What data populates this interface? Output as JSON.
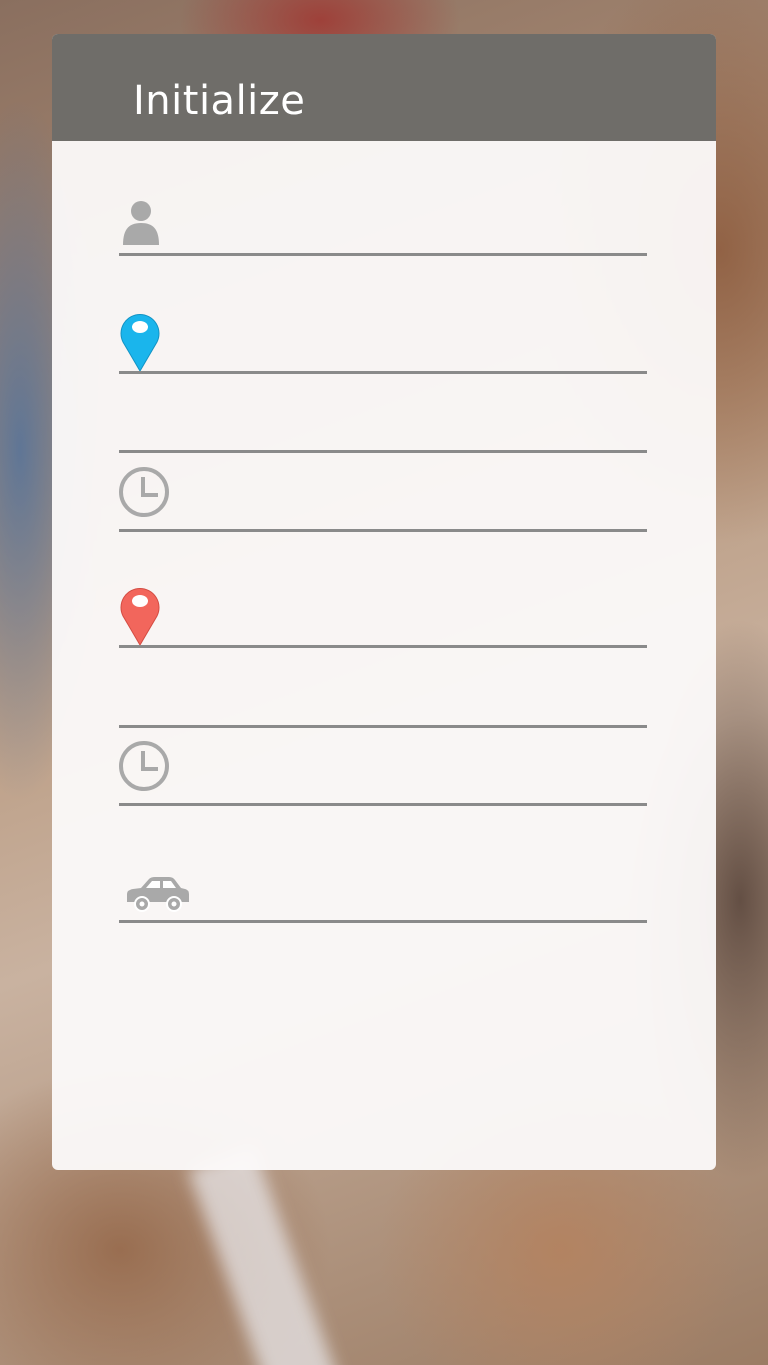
{
  "header": {
    "title": "Initialize"
  },
  "form": {
    "fields": [
      {
        "name": "name",
        "icon": "person-icon",
        "value": ""
      },
      {
        "name": "pickup-location",
        "icon": "pin-blue-icon",
        "value": ""
      },
      {
        "name": "pickup-location-detail",
        "icon": "",
        "value": ""
      },
      {
        "name": "pickup-time",
        "icon": "clock-icon",
        "value": ""
      },
      {
        "name": "dropoff-location",
        "icon": "pin-red-icon",
        "value": ""
      },
      {
        "name": "dropoff-location-detail",
        "icon": "",
        "value": ""
      },
      {
        "name": "dropoff-time",
        "icon": "clock-icon",
        "value": ""
      },
      {
        "name": "vehicle",
        "icon": "car-icon",
        "value": ""
      }
    ]
  },
  "colors": {
    "header_bg": "#6f6d69",
    "pin_blue": "#1ab5ec",
    "pin_red": "#f2665c",
    "icon_gray": "#a9a9a9",
    "line_gray": "#8a8a8a"
  }
}
